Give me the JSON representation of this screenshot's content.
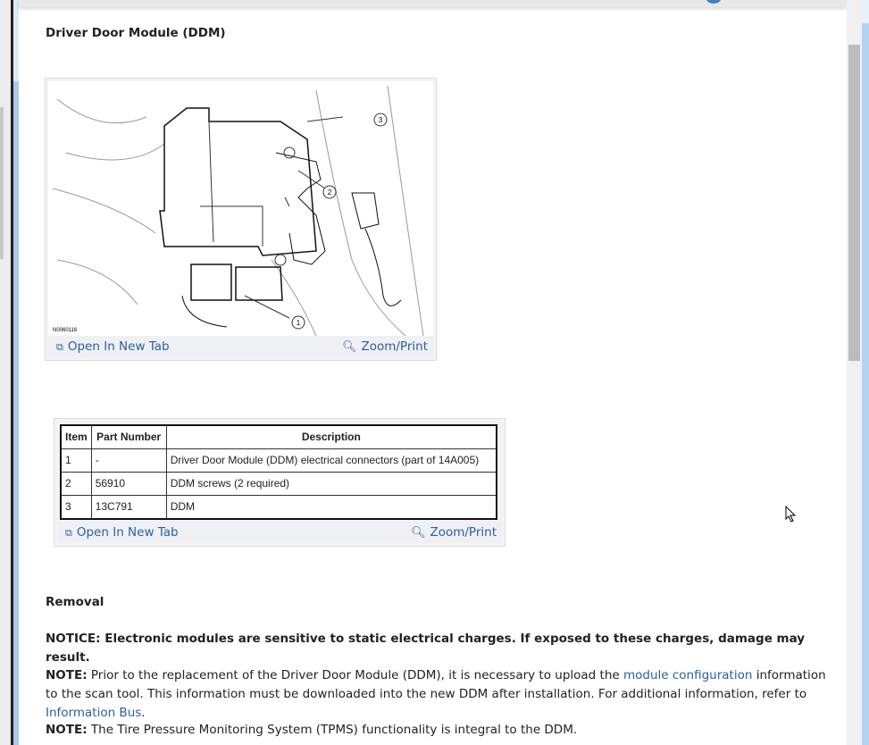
{
  "section_title": "Driver Door Module (DDM)",
  "figure1": {
    "code": "N0060116",
    "callouts": [
      "1",
      "2",
      "3"
    ],
    "open_label": "Open In New Tab",
    "zoom_label": "Zoom/Print"
  },
  "table": {
    "headers": [
      "Item",
      "Part Number",
      "Description"
    ],
    "rows": [
      [
        "1",
        "-",
        "Driver Door Module (DDM) electrical connectors (part of 14A005)"
      ],
      [
        "2",
        "56910",
        "DDM screws (2 required)"
      ],
      [
        "3",
        "13C791",
        "DDM"
      ]
    ],
    "open_label": "Open In New Tab",
    "zoom_label": "Zoom/Print"
  },
  "removal_heading": "Removal",
  "notice": "NOTICE: Electronic modules are sensitive to static electrical charges. If exposed to these charges, damage may result.",
  "note1": {
    "label": "NOTE:",
    "text_a": " Prior to the replacement of the Driver Door Module (DDM), it is necessary to upload the ",
    "link1": "module configuration",
    "text_b": " information to the scan tool. This information must be downloaded into the new DDM after installation. For additional information, refer to ",
    "link2": "Information Bus",
    "text_c": "."
  },
  "note2": {
    "label": "NOTE:",
    "text": " The Tire Pressure Monitoring System (TPMS) functionality is integral to the DDM."
  }
}
